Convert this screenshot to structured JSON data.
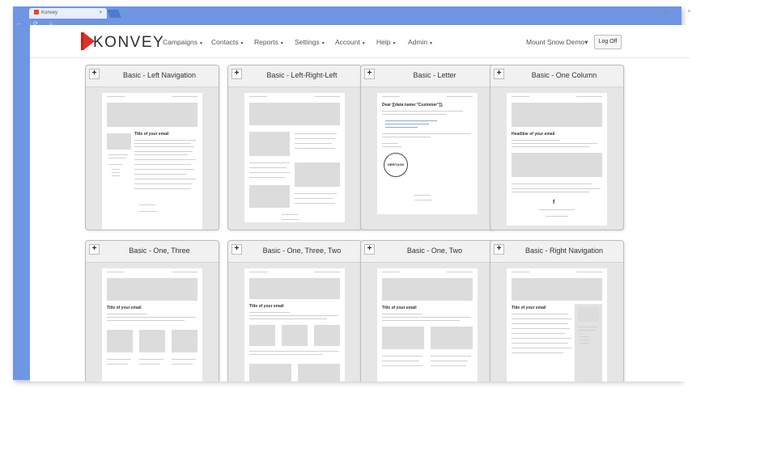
{
  "browser": {
    "tab_title": "Konvey",
    "tab_close": "×",
    "nav_arrows": "← ⟳ ⌂",
    "window_controls": "– ▢ ×"
  },
  "header": {
    "logo_text": "KONVEY",
    "nav": [
      {
        "label": "Campaigns"
      },
      {
        "label": "Contacts"
      },
      {
        "label": "Reports"
      },
      {
        "label": "Settings"
      },
      {
        "label": "Account"
      },
      {
        "label": "Help"
      },
      {
        "label": "Admin"
      }
    ],
    "caret": "▾",
    "org_selector": "Mount Snow Demo",
    "logoff": "Log Off"
  },
  "templates": [
    {
      "title": "Basic - Left Navigation",
      "heading": "Title of your email",
      "layout": "left-nav"
    },
    {
      "title": "Basic - Left-Right-Left",
      "heading": "",
      "layout": "lrl"
    },
    {
      "title": "Basic - Letter",
      "heading": "Dear [[data:name:\"Customer\"]],",
      "layout": "letter",
      "badge": "HERITAGE"
    },
    {
      "title": "Basic - One Column",
      "heading": "Headline of your email",
      "layout": "one-col"
    },
    {
      "title": "Basic - One, Three",
      "heading": "Title of your email",
      "layout": "one-three"
    },
    {
      "title": "Basic - One, Three, Two",
      "heading": "Title of your email",
      "layout": "one-three-two"
    },
    {
      "title": "Basic - One, Two",
      "heading": "Title of your email",
      "layout": "one-two"
    },
    {
      "title": "Basic - Right Navigation",
      "heading": "Title of your email",
      "layout": "right-nav"
    }
  ],
  "colors": {
    "frame": "#6f96e3",
    "brand_red": "#d9322b",
    "card_bg": "#e6e6e6"
  }
}
